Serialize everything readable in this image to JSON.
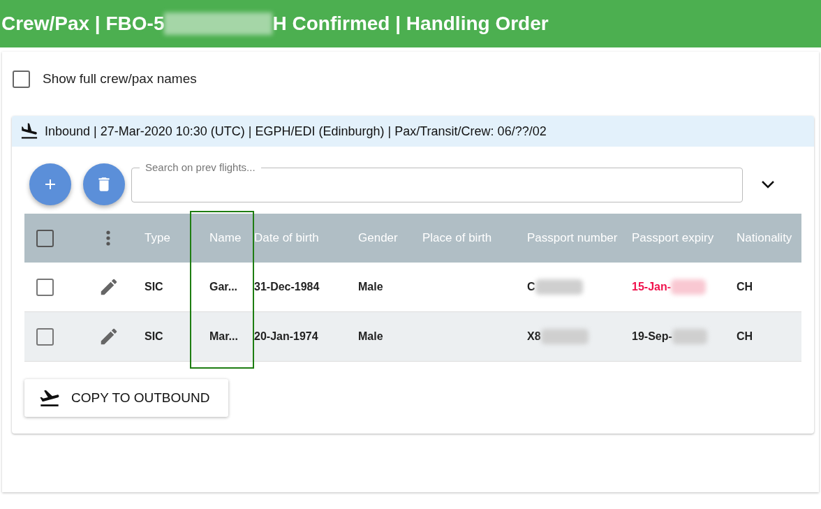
{
  "title": {
    "parts": [
      {
        "text": "Crew/Pax | FBO-5",
        "redacted": true
      },
      {
        "text": "H Confirmed | Handling Order",
        "redacted": false
      }
    ]
  },
  "show_full_names": {
    "label": "Show full crew/pax names",
    "checked": false
  },
  "section": {
    "header": "Inbound | 27-Mar-2020 10:30 (UTC) | EGPH/EDI (Edinburgh) | Pax/Transit/Crew: 06/??/02",
    "search": {
      "placeholder": "Search on prev flights..."
    },
    "table": {
      "select_all": {
        "checked": false
      },
      "columns": [
        "Type",
        "Name",
        "Date of birth",
        "Gender",
        "Place of birth",
        "Passport number",
        "Passport expiry",
        "Nationality"
      ],
      "rows": [
        {
          "checked": false,
          "cells": [
            {
              "text": "SIC"
            },
            {
              "text": "Gar..."
            },
            {
              "text": "31-Dec-1984"
            },
            {
              "text": "Male"
            },
            {
              "text": ""
            },
            {
              "text": "C",
              "redacted": true
            },
            {
              "text": "15-Jan-",
              "redacted": true,
              "expired": true
            },
            {
              "text": "CH"
            }
          ]
        },
        {
          "checked": false,
          "cells": [
            {
              "text": "SIC"
            },
            {
              "text": "Mar..."
            },
            {
              "text": "20-Jan-1974"
            },
            {
              "text": "Male"
            },
            {
              "text": ""
            },
            {
              "text": "X8",
              "redacted": true
            },
            {
              "text": "19-Sep-",
              "redacted": true,
              "expired": false
            },
            {
              "text": "CH"
            }
          ]
        }
      ]
    },
    "copy_button": "COPY TO OUTBOUND"
  }
}
